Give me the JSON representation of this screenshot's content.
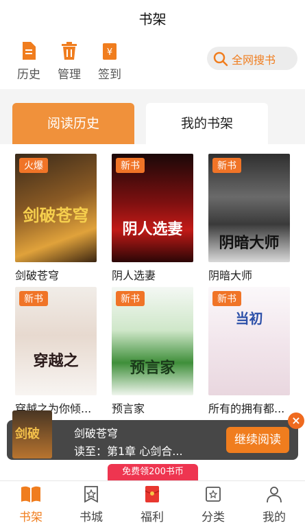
{
  "header": {
    "title": "书架"
  },
  "toolbar": {
    "items": [
      {
        "label": "历史",
        "icon": "document-icon"
      },
      {
        "label": "管理",
        "icon": "trash-icon"
      },
      {
        "label": "签到",
        "icon": "wallet-icon"
      }
    ],
    "search_label": "全网搜书"
  },
  "tabs": [
    {
      "label": "阅读历史",
      "active": true
    },
    {
      "label": "我的书架",
      "active": false
    }
  ],
  "books": [
    {
      "name": "剑破苍穹",
      "badge": "火爆",
      "cover_text": "剑破苍穹"
    },
    {
      "name": "阴人选妻",
      "badge": "新书",
      "cover_text": "阴人选妻"
    },
    {
      "name": "阴暗大师",
      "badge": "新书",
      "cover_text": "阴暗大师"
    },
    {
      "name": "穿越之为你倾...",
      "badge": "新书",
      "cover_text": "穿越之"
    },
    {
      "name": "预言家",
      "badge": "新书",
      "cover_text": "预言家"
    },
    {
      "name": "所有的拥有都...",
      "badge": "新书",
      "cover_text": "当初"
    }
  ],
  "reading": {
    "title": "剑破苍穹",
    "progress": "读至：第1章 心剑合...",
    "continue_label": "继续阅读",
    "close_label": "×",
    "thumb_text": "剑破"
  },
  "promo": "免费领200书币",
  "bottom_nav": [
    {
      "label": "书架",
      "active": true
    },
    {
      "label": "书城",
      "active": false
    },
    {
      "label": "福利",
      "active": false
    },
    {
      "label": "分类",
      "active": false
    },
    {
      "label": "我的",
      "active": false
    }
  ],
  "colors": {
    "accent": "#f07d1e",
    "tab_active": "#f0913b",
    "badge": "#f07427",
    "promo": "#ee3550"
  }
}
